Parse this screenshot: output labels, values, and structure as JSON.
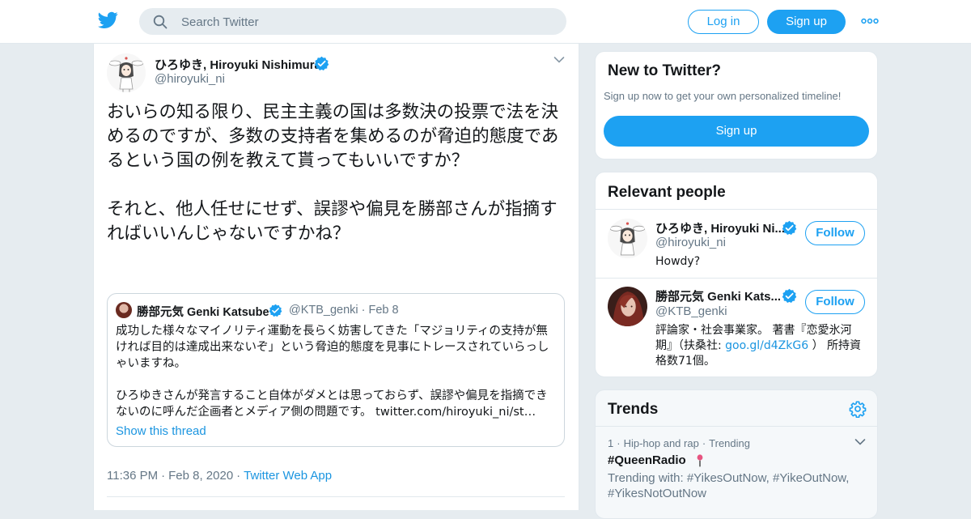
{
  "header": {
    "search_placeholder": "Search Twitter",
    "login_label": "Log in",
    "signup_label": "Sign up"
  },
  "tweet": {
    "author_name": "ひろゆき, Hiroyuki Nishimura",
    "author_handle": "@hiroyuki_ni",
    "text": "おいらの知る限り、民主主義の国は多数決の投票で法を決めるのですが、多数の支持者を集めるのが脅迫的態度であるという国の例を教えて貰ってもいいですか？\n\nそれと、他人任せにせず、誤謬や偏見を勝部さんが指摘すればいいんじゃないですかね？",
    "quoted": {
      "author_name": "勝部元気 Genki Katsube",
      "author_handle": "@KTB_genki",
      "date": "Feb 8",
      "text": "成功した様々なマイノリティ運動を長らく妨害してきた「マジョリティの支持が無ければ目的は達成出来ないぞ」という脅迫的態度を見事にトレースされていらっしゃいますね。\n\nひろゆきさんが発言すること自体がダメとは思っておらず、誤謬や偏見を指摘できないのに呼んだ企画者とメディア側の問題です。 twitter.com/hiroyuki_ni/st…",
      "show_thread": "Show this thread"
    },
    "time": "11:36 PM",
    "date": "Feb 8, 2020",
    "source": "Twitter Web App"
  },
  "new_to_twitter": {
    "title": "New to Twitter?",
    "subtitle": "Sign up now to get your own personalized timeline!",
    "button": "Sign up"
  },
  "relevant_people": {
    "title": "Relevant people",
    "people": [
      {
        "name": "ひろゆき, Hiroyuki Ni...",
        "handle": "@hiroyuki_ni",
        "bio": "Howdy?",
        "follow": "Follow"
      },
      {
        "name": "勝部元気 Genki Kats...",
        "handle": "@KTB_genki",
        "bio_text": "評論家・社会事業家。 著書『恋愛氷河期』（扶桑社: ",
        "bio_link": "goo.gl/d4ZkG6",
        "bio_tail": " ） 所持資格数71個。",
        "follow": "Follow"
      }
    ]
  },
  "trends": {
    "title": "Trends",
    "items": [
      {
        "rank": "1",
        "category": "Hip-hop and rap",
        "status": "Trending",
        "name": "#QueenRadio",
        "with": "Trending with: #YikesOutNow, #YikeOutNow, #YikesNotOutNow"
      }
    ]
  },
  "colors": {
    "brand": "#1da1f2",
    "link": "#1b95e0",
    "muted": "#657786",
    "background": "#e6ecf0"
  },
  "icons": [
    "twitter-logo-icon",
    "search-icon",
    "more-icon",
    "verified-icon",
    "chevron-down-icon",
    "gear-icon",
    "microphone-emoji-icon"
  ]
}
